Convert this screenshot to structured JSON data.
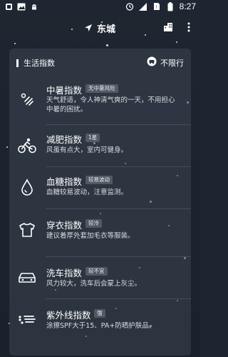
{
  "status_bar": {
    "time": "8:27"
  },
  "top_bar": {
    "location": "东城"
  },
  "card": {
    "title": "生活指数",
    "restriction": "不限行",
    "items": [
      {
        "title": "中暑指数",
        "badge": "无中暑风险",
        "desc": "天气舒适，令人神清气爽的一天，不用担心中暑的困扰。",
        "icon": "heatstroke-icon"
      },
      {
        "title": "减肥指数",
        "badge": "1星",
        "desc": "风虽有点大，室内可健身。",
        "icon": "cycling-icon"
      },
      {
        "title": "血糖指数",
        "badge": "较易波动",
        "desc": "血糖较易波动，注意监测。",
        "icon": "blood-drop-icon"
      },
      {
        "title": "穿衣指数",
        "badge": "较冷",
        "desc": "建议着厚外套加毛衣等服装。",
        "icon": "tshirt-icon"
      },
      {
        "title": "洗车指数",
        "badge": "较不宜",
        "desc": "风力较大，洗车后会蒙上灰尘。",
        "icon": "car-icon"
      },
      {
        "title": "紫外线指数",
        "badge": "强",
        "desc": "涂擦SPF大于15、PA+防晒护肤品。",
        "icon": "uv-icon"
      }
    ]
  }
}
